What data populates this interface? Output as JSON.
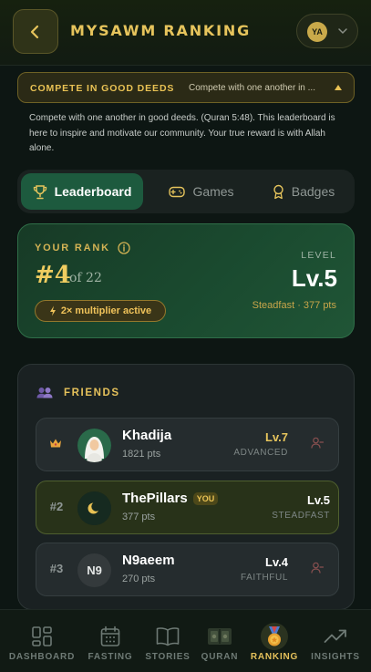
{
  "header": {
    "title": "MYSAWM RANKING",
    "avatar_initials": "YA"
  },
  "banner": {
    "title": "COMPETE IN GOOD DEEDS",
    "preview": "Compete with one another in ...",
    "body": "Compete with one another in good deeds. (Quran 5:48). This leaderboard is here to inspire and motivate our community. Your true reward is with Allah alone."
  },
  "tabs": [
    {
      "label": "Leaderboard",
      "icon": "trophy-icon",
      "active": true
    },
    {
      "label": "Games",
      "icon": "gamepad-icon",
      "active": false
    },
    {
      "label": "Badges",
      "icon": "badge-icon",
      "active": false
    }
  ],
  "rank": {
    "label": "YOUR RANK",
    "position": "#4",
    "of_total": "of 22",
    "multiplier": "2× multiplier active",
    "level_label": "LEVEL",
    "level": "Lv.5",
    "sub": "Steadfast · 377 pts"
  },
  "friends": {
    "title": "FRIENDS",
    "rows": [
      {
        "rank": "",
        "name": "Khadija",
        "pts": "1821 pts",
        "level": "Lv.7",
        "tier": "ADVANCED",
        "you": false,
        "avatar": "hijab-avatar",
        "rank_icon": "crown-icon",
        "level_color": "#e6c45c"
      },
      {
        "rank": "#2",
        "name": "ThePillars",
        "pts": "377 pts",
        "level": "Lv.5",
        "tier": "STEADFAST",
        "you": true,
        "you_label": "YOU",
        "avatar": "moon-avatar",
        "level_color": "#ffffff"
      },
      {
        "rank": "#3",
        "name": "N9aeem",
        "pts": "270 pts",
        "level": "Lv.4",
        "tier": "FAITHFUL",
        "you": false,
        "avatar_text": "N9",
        "level_color": "#ffffff"
      }
    ]
  },
  "nav": [
    {
      "label": "DASHBOARD",
      "icon": "dashboard-icon",
      "active": false
    },
    {
      "label": "FASTING",
      "icon": "calendar-icon",
      "active": false
    },
    {
      "label": "STORIES",
      "icon": "book-icon",
      "active": false
    },
    {
      "label": "QURAN",
      "icon": "quran-icon",
      "active": false
    },
    {
      "label": "RANKING",
      "icon": "medal-icon",
      "active": true
    },
    {
      "label": "INSIGHTS",
      "icon": "chart-icon",
      "active": false
    }
  ],
  "colors": {
    "accent_gold": "#e6c45c",
    "active_green": "#1d5a3e",
    "background": "#0d1613"
  }
}
